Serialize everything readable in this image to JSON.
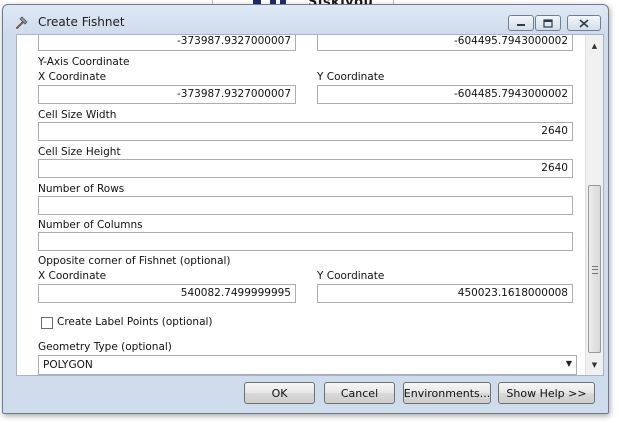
{
  "background": {
    "map_text": "Siskiyou"
  },
  "window": {
    "title": "Create Fishnet",
    "icons": {
      "app": "hammer-icon",
      "minimize": "minimize-icon",
      "maximize": "maximize-icon",
      "close": "close-icon"
    }
  },
  "form": {
    "top_row": {
      "x_value": "-373987.9327000007",
      "y_value": "-604495.7943000002"
    },
    "y_axis_label": "Y-Axis Coordinate",
    "y_axis": {
      "x_label": "X Coordinate",
      "x_value": "-373987.9327000007",
      "y_label": "Y Coordinate",
      "y_value": "-604485.7943000002"
    },
    "cell_width": {
      "label": "Cell Size Width",
      "value": "2640"
    },
    "cell_height": {
      "label": "Cell Size Height",
      "value": "2640"
    },
    "rows": {
      "label": "Number of Rows",
      "value": ""
    },
    "columns": {
      "label": "Number of Columns",
      "value": ""
    },
    "opposite_corner": {
      "label": "Opposite corner of Fishnet (optional)",
      "x_label": "X Coordinate",
      "x_value": "540082.7499999995",
      "y_label": "Y Coordinate",
      "y_value": "450023.1618000008"
    },
    "label_points": {
      "label": "Create Label Points (optional)",
      "checked": false
    },
    "geometry": {
      "label": "Geometry Type (optional)",
      "value": "POLYGON"
    }
  },
  "buttons": {
    "ok": "OK",
    "cancel": "Cancel",
    "environments": "Environments...",
    "help": "Show Help >>"
  }
}
